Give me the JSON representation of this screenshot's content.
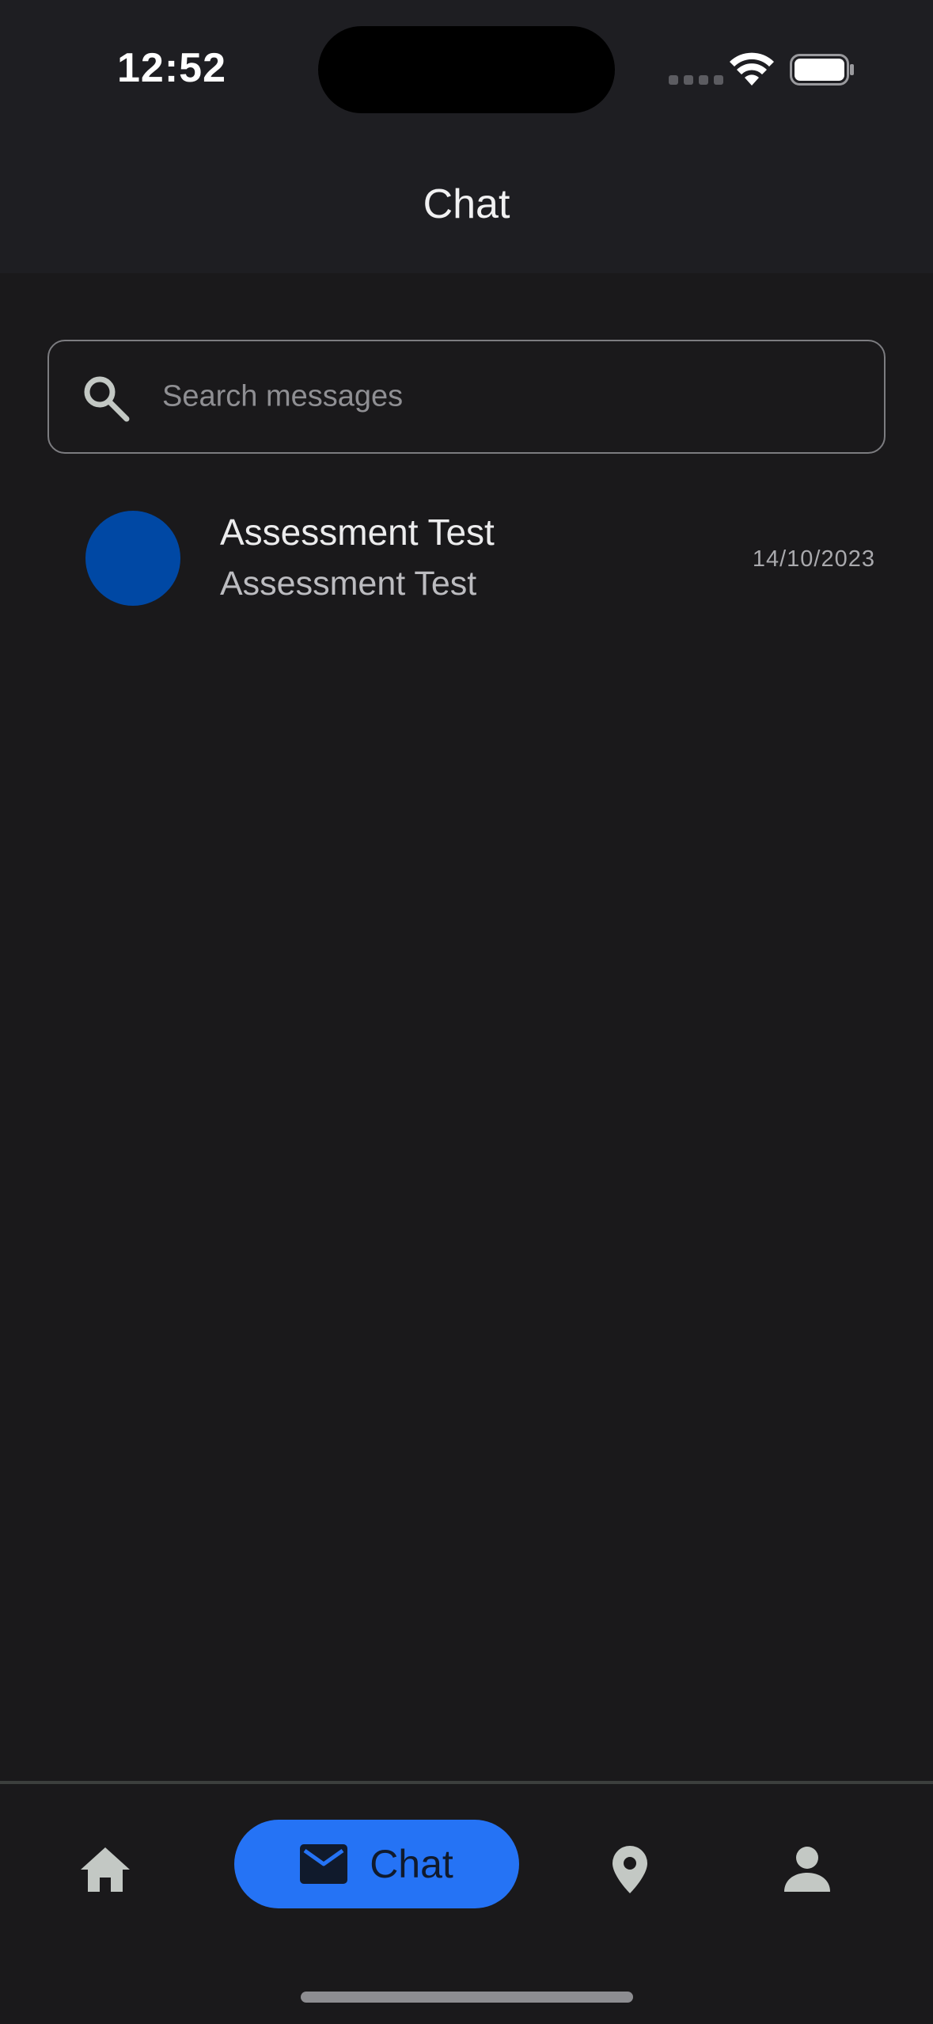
{
  "status_bar": {
    "time": "12:52"
  },
  "header": {
    "title": "Chat"
  },
  "search": {
    "placeholder": "Search messages",
    "icon": "search-icon"
  },
  "conversations": [
    {
      "name": "Assessment Test",
      "preview": "Assessment Test",
      "date": "14/10/2023",
      "avatar_color": "#0048a4"
    }
  ],
  "bottom_nav": {
    "items": [
      {
        "id": "home",
        "icon": "home-icon",
        "label": "",
        "active": false
      },
      {
        "id": "chat",
        "icon": "mail-icon",
        "label": "Chat",
        "active": true
      },
      {
        "id": "map",
        "icon": "location-pin-icon",
        "label": "",
        "active": false
      },
      {
        "id": "profile",
        "icon": "person-icon",
        "label": "",
        "active": false
      }
    ]
  },
  "colors": {
    "accent": "#2573f5",
    "background": "#1a191b",
    "header_background": "#1e1e22",
    "inactive_icon": "#c3c8c4"
  }
}
